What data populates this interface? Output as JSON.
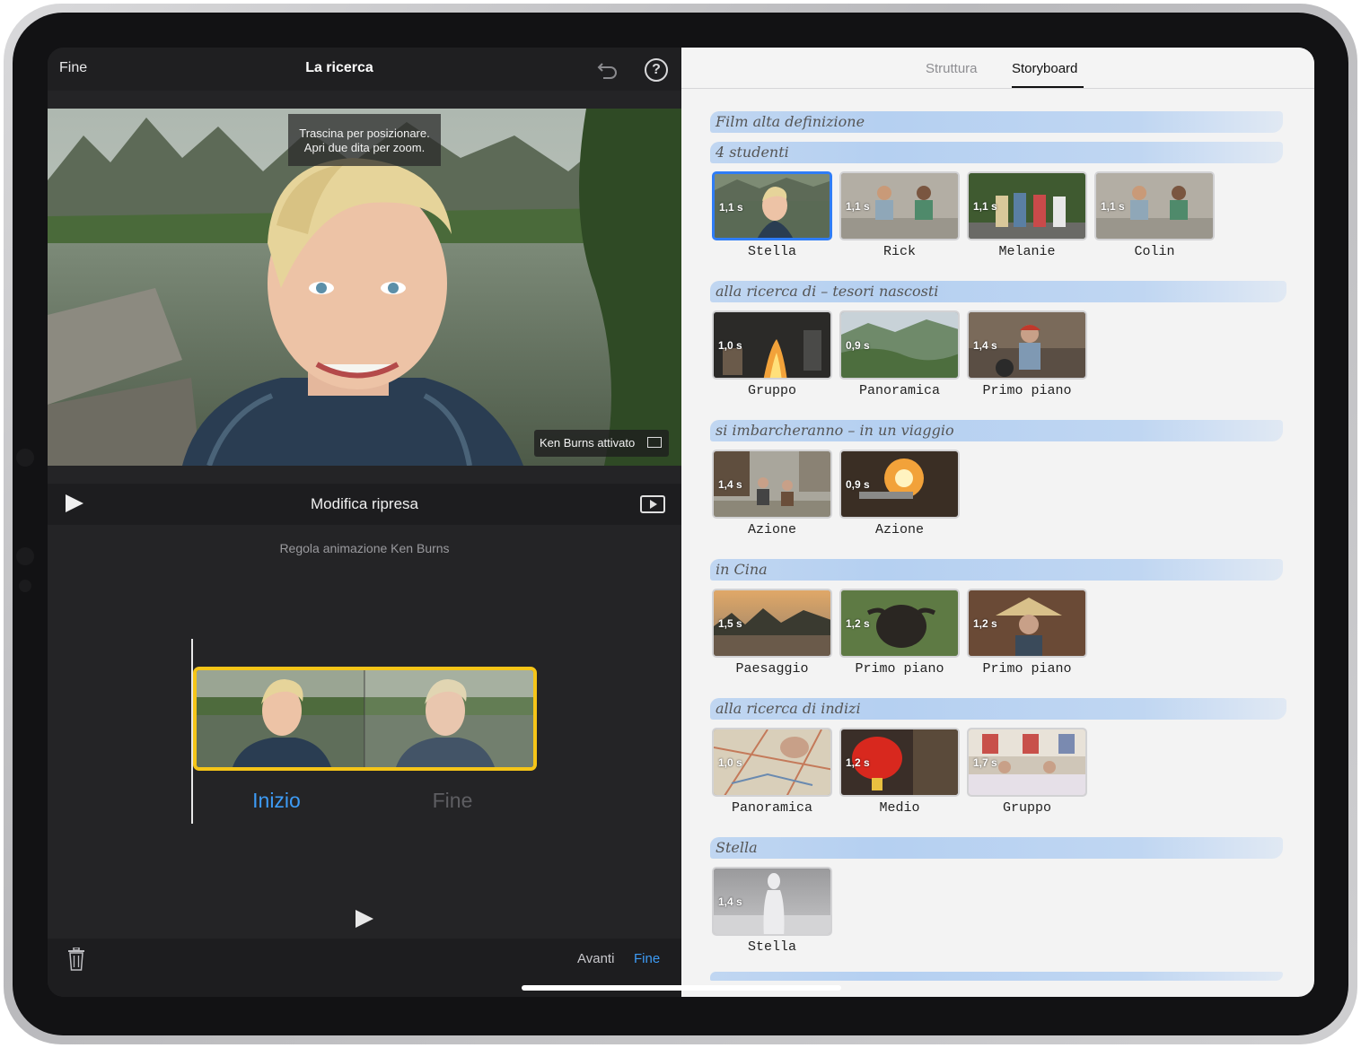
{
  "left": {
    "done_label": "Fine",
    "project_title": "La ricerca",
    "help_label": "?",
    "viewer_hint_line1": "Trascina per posizionare.",
    "viewer_hint_line2": "Apri due dita per zoom.",
    "ken_burns_badge": "Ken Burns attivato",
    "edit_title": "Modifica ripresa",
    "kb_caption": "Regola animazione Ken Burns",
    "start_label": "Inizio",
    "end_label": "Fine",
    "next_label": "Avanti",
    "finish_label": "Fine"
  },
  "tabs": {
    "structure": "Struttura",
    "storyboard": "Storyboard",
    "active": "Storyboard"
  },
  "sections": [
    {
      "title": "Film alta definizione"
    },
    {
      "title": "4 studenti",
      "clips": [
        {
          "duration": "1,1 s",
          "label": "Stella",
          "selected": true
        },
        {
          "duration": "1,1 s",
          "label": "Rick"
        },
        {
          "duration": "1,1 s",
          "label": "Melanie"
        },
        {
          "duration": "1,1 s",
          "label": "Colin"
        }
      ]
    },
    {
      "title": "alla ricerca di – tesori nascosti",
      "clips": [
        {
          "duration": "1,0 s",
          "label": "Gruppo"
        },
        {
          "duration": "0,9 s",
          "label": "Panoramica"
        },
        {
          "duration": "1,4 s",
          "label": "Primo piano"
        }
      ]
    },
    {
      "title": "si imbarcheranno – in un viaggio",
      "clips": [
        {
          "duration": "1,4 s",
          "label": "Azione"
        },
        {
          "duration": "0,9 s",
          "label": "Azione"
        }
      ]
    },
    {
      "title": "in Cina",
      "clips": [
        {
          "duration": "1,5 s",
          "label": "Paesaggio"
        },
        {
          "duration": "1,2 s",
          "label": "Primo piano"
        },
        {
          "duration": "1,2 s",
          "label": "Primo piano"
        }
      ]
    },
    {
      "title": "alla ricerca di indizi",
      "clips": [
        {
          "duration": "1,0 s",
          "label": "Panoramica"
        },
        {
          "duration": "1,2 s",
          "label": "Medio"
        },
        {
          "duration": "1,7 s",
          "label": "Gruppo"
        }
      ]
    },
    {
      "title": "Stella",
      "clips": [
        {
          "duration": "1,4 s",
          "label": "Stella"
        }
      ]
    }
  ],
  "colors": {
    "accent_blue": "#3d9bf5",
    "selection_yellow": "#f5c518",
    "selected_clip_border": "#2f7df6"
  }
}
